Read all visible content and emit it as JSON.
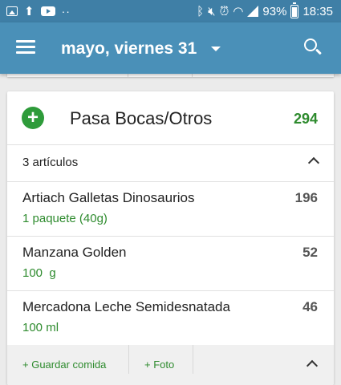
{
  "status_bar": {
    "battery_percent": "93%",
    "time": "18:35",
    "icons_left": [
      "image-icon",
      "upload-icon",
      "youtube-icon",
      "more-dots-icon"
    ],
    "icons_right": [
      "bluetooth-icon",
      "mute-icon",
      "alarm-icon",
      "wifi-icon",
      "signal-icon",
      "battery-icon"
    ]
  },
  "app_bar": {
    "title": "mayo, viernes 31",
    "colors": {
      "bar": "#4a90b8",
      "status": "#3f7fa6"
    }
  },
  "meal": {
    "name": "Pasa Bocas/Otros",
    "total_calories": "294",
    "item_count_label": "3 artículos",
    "items": [
      {
        "name": "Artiach Galletas Dinosaurios",
        "portion": "1 paquete (40g)",
        "calories": "196"
      },
      {
        "name": "Manzana Golden",
        "portion": "100  g",
        "calories": "52"
      },
      {
        "name": "Mercadona Leche Semidesnatada",
        "portion": "100 ml",
        "calories": "46"
      }
    ],
    "footer": {
      "save_meal_label": "+ Guardar comida",
      "photo_label": "+ Foto"
    },
    "accent_color": "#2e8b2e"
  }
}
